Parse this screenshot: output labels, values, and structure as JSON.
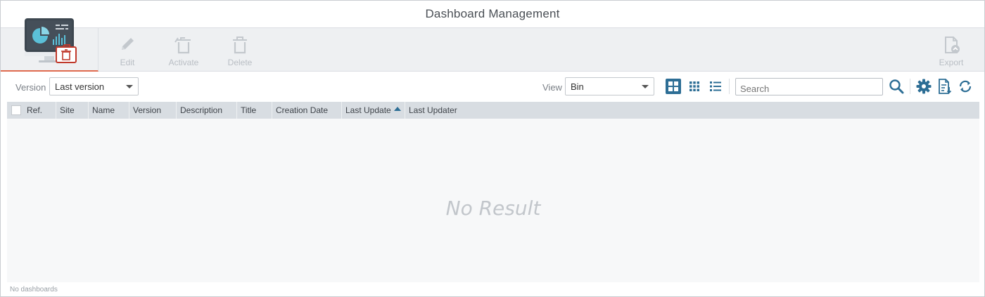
{
  "window": {
    "title": "Dashboard Management"
  },
  "ribbon": {
    "app_icon": "dashboard-bin-icon",
    "buttons": [
      {
        "label": "Edit",
        "icon": "pencil-icon",
        "enabled": false
      },
      {
        "label": "Activate",
        "icon": "activate-icon",
        "enabled": false
      },
      {
        "label": "Delete",
        "icon": "trash-icon",
        "enabled": false
      },
      {
        "label": "Export",
        "icon": "export-icon",
        "enabled": false
      }
    ]
  },
  "toolbar": {
    "version_label": "Version",
    "version_value": "Last version",
    "view_label": "View",
    "view_value": "Bin",
    "view_modes": [
      "large-tiles-icon",
      "small-tiles-icon",
      "list-icon"
    ],
    "active_view_mode": "large-tiles-icon",
    "search_placeholder": "Search",
    "actions": [
      "search-icon",
      "gear-icon",
      "csv-export-icon",
      "refresh-icon"
    ]
  },
  "grid": {
    "columns": [
      "Ref.",
      "Site",
      "Name",
      "Version",
      "Description",
      "Title",
      "Creation Date",
      "Last Update",
      "Last Updater"
    ],
    "sorted_column": "Last Update",
    "sort_direction": "ascending",
    "empty_text": "No Result"
  },
  "status": {
    "text": "No dashboards"
  },
  "colors": {
    "accent": "#2d6e95",
    "tab_underline": "#e06b4f",
    "disabled": "#b9bec4",
    "header_bg": "#d8dde2"
  }
}
